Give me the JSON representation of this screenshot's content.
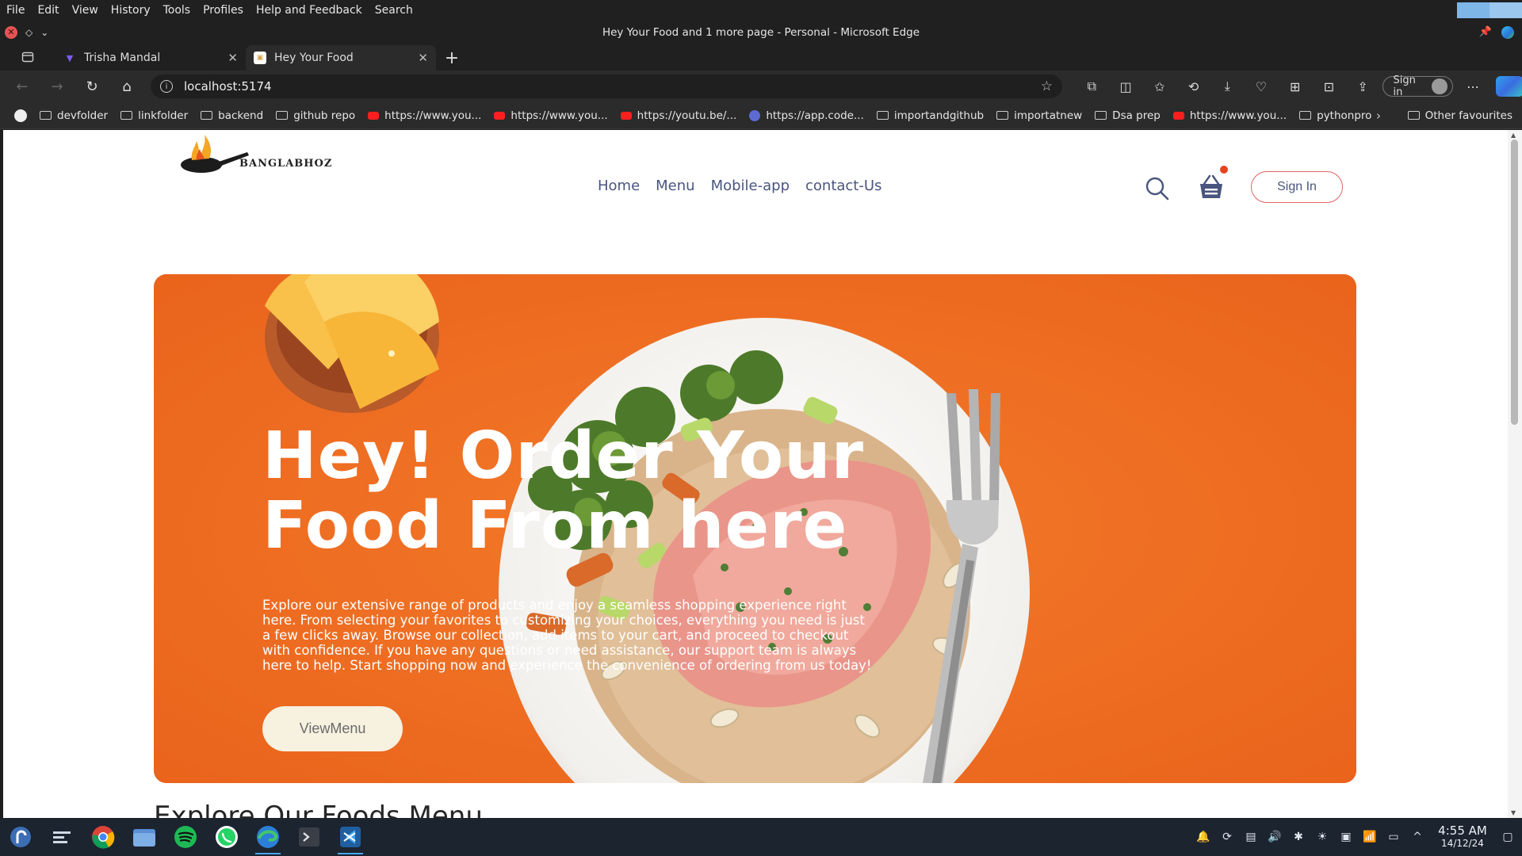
{
  "menubar": {
    "items": [
      "File",
      "Edit",
      "View",
      "History",
      "Tools",
      "Profiles",
      "Help and Feedback",
      "Search"
    ]
  },
  "window": {
    "title": "Hey Your Food and 1 more page - Personal - Microsoft Edge"
  },
  "tabs": [
    {
      "title": "Trisha Mandal",
      "favicon_color": "#7b5cf5"
    },
    {
      "title": "Hey Your Food",
      "favicon_color": "#d8a24a",
      "active": true
    }
  ],
  "address": {
    "url": "localhost:5174"
  },
  "profile": {
    "label": "Sign in"
  },
  "bookmarks": [
    {
      "label": "devfolder",
      "icon": "folder-icon"
    },
    {
      "label": "linkfolder",
      "icon": "folder-icon"
    },
    {
      "label": "backend",
      "icon": "folder-icon"
    },
    {
      "label": "github repo",
      "icon": "folder-icon"
    },
    {
      "label": "https://www.you...",
      "icon": "youtube-icon"
    },
    {
      "label": "https://www.you...",
      "icon": "youtube-icon"
    },
    {
      "label": "https://youtu.be/...",
      "icon": "youtube-icon"
    },
    {
      "label": "https://app.code...",
      "icon": "codeium-icon"
    },
    {
      "label": "importandgithub",
      "icon": "folder-icon"
    },
    {
      "label": "importatnew",
      "icon": "folder-icon"
    },
    {
      "label": "Dsa prep",
      "icon": "folder-icon"
    },
    {
      "label": "https://www.you...",
      "icon": "youtube-icon"
    },
    {
      "label": "pythonpro",
      "icon": "folder-icon"
    }
  ],
  "bookmarks_other": "Other favourites",
  "site": {
    "brand": "BANGLABHOZ",
    "nav": [
      "Home",
      "Menu",
      "Mobile-app",
      "contact-Us"
    ],
    "signin": "Sign In",
    "hero": {
      "title_line1": "Hey! Order Your",
      "title_line2": "Food From here",
      "text": "Explore our extensive range of products and enjoy a seamless shopping experience right here. From selecting your favorites to customizing your choices, everything you need is just a few clicks away. Browse our collection, add items to your cart, and proceed to checkout with confidence. If you have any questions or need assistance, our support team is always here to help. Start shopping now and experience the convenience of ordering from us today!",
      "button": "ViewMenu"
    },
    "section_title": "Explore Our Foods Menu"
  },
  "taskbar": {
    "time": "4:55 AM",
    "date": "14/12/24"
  },
  "colors": {
    "hero_bg": "#ee6b1e",
    "signin_border": "#e06464",
    "nav_text": "#49557e"
  }
}
